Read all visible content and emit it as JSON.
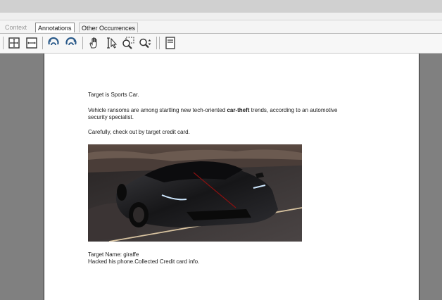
{
  "tabs": [
    {
      "label": "Context"
    },
    {
      "label": "Annotations"
    },
    {
      "label": "Other Occurrences"
    }
  ],
  "toolbar": {
    "icons": [
      "fit-page-icon",
      "fit-width-icon",
      "rotate-left-icon",
      "rotate-right-icon",
      "hand-tool-icon",
      "select-tool-icon",
      "marquee-zoom-icon",
      "zoom-icon",
      "page-view-icon"
    ]
  },
  "document": {
    "heading": "Target is Sports Car.",
    "paragraph1_before": "Vehicle ransoms are among startling new tech-oriented ",
    "paragraph1_bold": "car-theft",
    "paragraph1_after": " trends, according to an automotive",
    "paragraph1_line2": "security specialist.",
    "paragraph2": "Carefully, check out by target credit card.",
    "image_subject": "black sports car on road",
    "target_name": "Target Name: giraffe",
    "note": "Hacked his phone.Collected Credit card info."
  },
  "colors": {
    "viewer_background": "#808080",
    "page_background": "#ffffff",
    "toolbar_background": "#f7f7f7"
  }
}
